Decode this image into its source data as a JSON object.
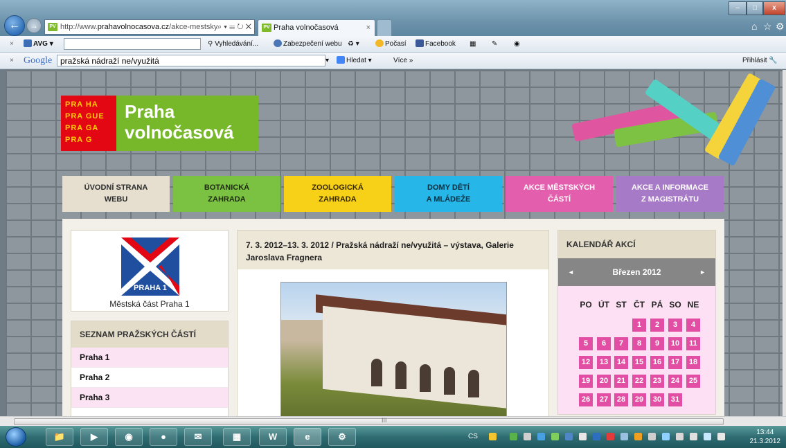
{
  "browser": {
    "address_prefix": "http://www.",
    "address_host": "prahavolnocasova.cz",
    "address_path": "/akce-mestsky",
    "address_controls": "⌕ ▾ ☰ ↻ ✕",
    "favicon_text": "PV",
    "tab_title": "Praha volnočasová",
    "tab_close": "×",
    "window_min": "–",
    "window_max": "□",
    "window_close": "x"
  },
  "toolbar_avg": {
    "close_glyph": "×",
    "avg_label": "AVG",
    "search_label": "Vyhledávání...",
    "security_label": "Zabezpečení webu",
    "weather_label": "Počasí",
    "facebook_label": "Facebook"
  },
  "toolbar_google": {
    "close_glyph": "×",
    "google_label": "Google",
    "query": "pražská nádraží ne/využitá",
    "search_button": "Hledat",
    "more_label": "Více »",
    "login_label": "Přihlásit"
  },
  "site": {
    "logo_lines": [
      "PRA HA",
      "PRA GUE",
      "PRA GA",
      "PRA G"
    ],
    "logo_name_1": "Praha",
    "logo_name_2": "volnočasová"
  },
  "menu": [
    {
      "line1": "ÚVODNÍ STRANA",
      "line2": "WEBU"
    },
    {
      "line1": "BOTANICKÁ",
      "line2": "ZAHRADA"
    },
    {
      "line1": "ZOOLOGICKÁ",
      "line2": "ZAHRADA"
    },
    {
      "line1": "DOMY DĚTÍ",
      "line2": "A MLÁDEŽE"
    },
    {
      "line1": "AKCE MĚSTSKÝCH",
      "line2": "ČÁSTÍ"
    },
    {
      "line1": "AKCE A INFORMACE",
      "line2": "Z MAGISTRÁTU"
    }
  ],
  "sidebar": {
    "emblem_text": "PRAHA 1",
    "caption": "Městská část Praha 1",
    "list_title": "SEZNAM PRAŽSKÝCH ČÁSTÍ",
    "items": [
      "Praha 1",
      "Praha 2",
      "Praha 3"
    ]
  },
  "article": {
    "title_line1": "7. 3. 2012–13. 3. 2012 / Pražská nádraží ne/využitá – výstava, Galerie",
    "title_line2": "Jaroslava Fragnera"
  },
  "calendar": {
    "title": "KALENDÁŘ AKCÍ",
    "month": "Březen 2012",
    "prev": "◄",
    "next": "►",
    "weekdays": [
      "PO",
      "ÚT",
      "ST",
      "ČT",
      "PÁ",
      "SO",
      "NE"
    ],
    "days": [
      "1",
      "2",
      "3",
      "4",
      "5",
      "6",
      "7",
      "8",
      "9",
      "10",
      "11",
      "12",
      "13",
      "14",
      "15",
      "16",
      "17",
      "18",
      "19",
      "20",
      "21",
      "22",
      "23",
      "24",
      "25",
      "26",
      "27",
      "28",
      "29",
      "30",
      "31"
    ]
  },
  "scrollbar": {
    "grip": "III"
  },
  "taskbar": {
    "language": "CS",
    "time": "13:44",
    "date": "21.3.2012"
  }
}
